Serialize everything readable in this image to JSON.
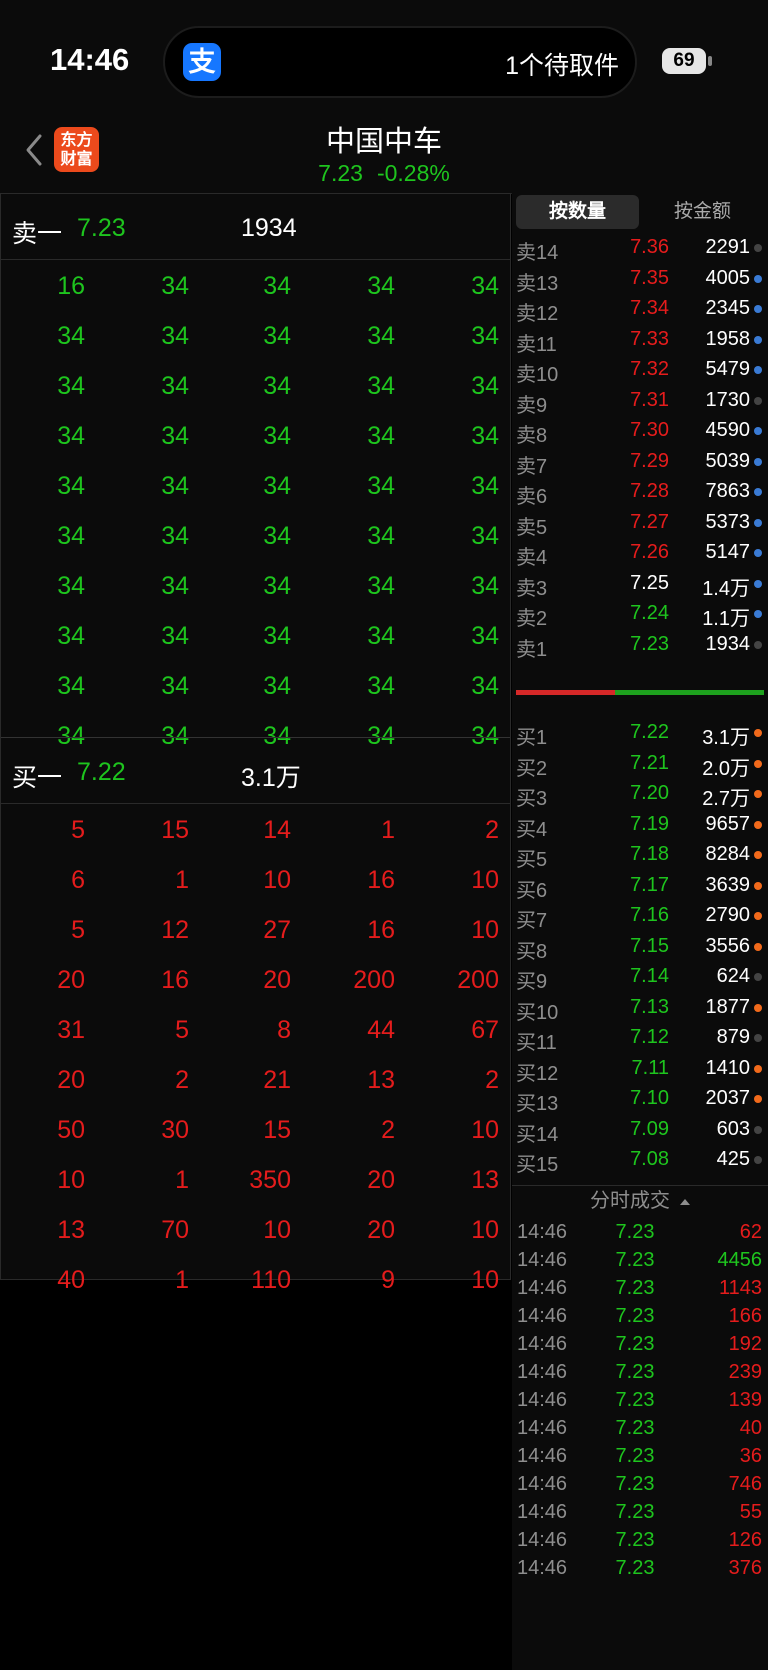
{
  "status_bar": {
    "time": "14:46",
    "app_badge": "支",
    "notification": "1个待取件",
    "battery": "69"
  },
  "header": {
    "logo_line1": "东方",
    "logo_line2": "财富",
    "name": "中国中车",
    "price": "7.23",
    "change_pct": "-0.28%"
  },
  "left": {
    "sell": {
      "label": "卖一",
      "price": "7.23",
      "volume": "1934",
      "grid": [
        [
          "16",
          "34",
          "34",
          "34",
          "34"
        ],
        [
          "34",
          "34",
          "34",
          "34",
          "34"
        ],
        [
          "34",
          "34",
          "34",
          "34",
          "34"
        ],
        [
          "34",
          "34",
          "34",
          "34",
          "34"
        ],
        [
          "34",
          "34",
          "34",
          "34",
          "34"
        ],
        [
          "34",
          "34",
          "34",
          "34",
          "34"
        ],
        [
          "34",
          "34",
          "34",
          "34",
          "34"
        ],
        [
          "34",
          "34",
          "34",
          "34",
          "34"
        ],
        [
          "34",
          "34",
          "34",
          "34",
          "34"
        ],
        [
          "34",
          "34",
          "34",
          "34",
          "34"
        ]
      ]
    },
    "buy": {
      "label": "买一",
      "price": "7.22",
      "volume": "3.1万",
      "grid": [
        [
          "5",
          "15",
          "14",
          "1",
          "2"
        ],
        [
          "6",
          "1",
          "10",
          "16",
          "10"
        ],
        [
          "5",
          "12",
          "27",
          "16",
          "10"
        ],
        [
          "20",
          "16",
          "20",
          "200",
          "200"
        ],
        [
          "31",
          "5",
          "8",
          "44",
          "67"
        ],
        [
          "20",
          "2",
          "21",
          "13",
          "2"
        ],
        [
          "50",
          "30",
          "15",
          "2",
          "10"
        ],
        [
          "10",
          "1",
          "350",
          "20",
          "13"
        ],
        [
          "13",
          "70",
          "10",
          "20",
          "10"
        ],
        [
          "40",
          "1",
          "110",
          "9",
          "10"
        ]
      ]
    }
  },
  "right": {
    "tabs": [
      "按数量",
      "按金额"
    ],
    "colors": {
      "blue_dot": "#3a7bd5",
      "grey_dot": "#444444",
      "orange_dot": "#f26a1b"
    },
    "asks": [
      {
        "label": "卖14",
        "price": "7.36",
        "volume": "2291",
        "dot": "grey"
      },
      {
        "label": "卖13",
        "price": "7.35",
        "volume": "4005",
        "dot": "blue"
      },
      {
        "label": "卖12",
        "price": "7.34",
        "volume": "2345",
        "dot": "blue"
      },
      {
        "label": "卖11",
        "price": "7.33",
        "volume": "1958",
        "dot": "blue"
      },
      {
        "label": "卖10",
        "price": "7.32",
        "volume": "5479",
        "dot": "blue"
      },
      {
        "label": "卖9",
        "price": "7.31",
        "volume": "1730",
        "dot": "grey"
      },
      {
        "label": "卖8",
        "price": "7.30",
        "volume": "4590",
        "dot": "blue"
      },
      {
        "label": "卖7",
        "price": "7.29",
        "volume": "5039",
        "dot": "blue"
      },
      {
        "label": "卖6",
        "price": "7.28",
        "volume": "7863",
        "dot": "blue"
      },
      {
        "label": "卖5",
        "price": "7.27",
        "volume": "5373",
        "dot": "blue"
      },
      {
        "label": "卖4",
        "price": "7.26",
        "volume": "5147",
        "dot": "blue"
      },
      {
        "label": "卖3",
        "price": "7.25",
        "volume": "1.4万",
        "dot": "blue"
      },
      {
        "label": "卖2",
        "price": "7.24",
        "volume": "1.1万",
        "dot": "blue"
      },
      {
        "label": "卖1",
        "price": "7.23",
        "volume": "1934",
        "dot": "grey"
      }
    ],
    "spread_red_fraction": 0.4,
    "bids": [
      {
        "label": "买1",
        "price": "7.22",
        "volume": "3.1万",
        "dot": "orange"
      },
      {
        "label": "买2",
        "price": "7.21",
        "volume": "2.0万",
        "dot": "orange"
      },
      {
        "label": "买3",
        "price": "7.20",
        "volume": "2.7万",
        "dot": "orange"
      },
      {
        "label": "买4",
        "price": "7.19",
        "volume": "9657",
        "dot": "orange"
      },
      {
        "label": "买5",
        "price": "7.18",
        "volume": "8284",
        "dot": "orange"
      },
      {
        "label": "买6",
        "price": "7.17",
        "volume": "3639",
        "dot": "orange"
      },
      {
        "label": "买7",
        "price": "7.16",
        "volume": "2790",
        "dot": "orange"
      },
      {
        "label": "买8",
        "price": "7.15",
        "volume": "3556",
        "dot": "orange"
      },
      {
        "label": "买9",
        "price": "7.14",
        "volume": "624",
        "dot": "grey"
      },
      {
        "label": "买10",
        "price": "7.13",
        "volume": "1877",
        "dot": "orange"
      },
      {
        "label": "买11",
        "price": "7.12",
        "volume": "879",
        "dot": "grey"
      },
      {
        "label": "买12",
        "price": "7.11",
        "volume": "1410",
        "dot": "orange"
      },
      {
        "label": "买13",
        "price": "7.10",
        "volume": "2037",
        "dot": "orange"
      },
      {
        "label": "买14",
        "price": "7.09",
        "volume": "603",
        "dot": "grey"
      },
      {
        "label": "买15",
        "price": "7.08",
        "volume": "425",
        "dot": "grey"
      }
    ],
    "ticks_title": "分时成交",
    "ticks": [
      {
        "time": "14:46",
        "price": "7.23",
        "volume": "62",
        "side": "buy"
      },
      {
        "time": "14:46",
        "price": "7.23",
        "volume": "4456",
        "side": "sell"
      },
      {
        "time": "14:46",
        "price": "7.23",
        "volume": "1143",
        "side": "buy"
      },
      {
        "time": "14:46",
        "price": "7.23",
        "volume": "166",
        "side": "buy"
      },
      {
        "time": "14:46",
        "price": "7.23",
        "volume": "192",
        "side": "buy"
      },
      {
        "time": "14:46",
        "price": "7.23",
        "volume": "239",
        "side": "buy"
      },
      {
        "time": "14:46",
        "price": "7.23",
        "volume": "139",
        "side": "buy"
      },
      {
        "time": "14:46",
        "price": "7.23",
        "volume": "40",
        "side": "buy"
      },
      {
        "time": "14:46",
        "price": "7.23",
        "volume": "36",
        "side": "buy"
      },
      {
        "time": "14:46",
        "price": "7.23",
        "volume": "746",
        "side": "buy"
      },
      {
        "time": "14:46",
        "price": "7.23",
        "volume": "55",
        "side": "buy"
      },
      {
        "time": "14:46",
        "price": "7.23",
        "volume": "126",
        "side": "buy"
      },
      {
        "time": "14:46",
        "price": "7.23",
        "volume": "376",
        "side": "buy"
      }
    ]
  }
}
